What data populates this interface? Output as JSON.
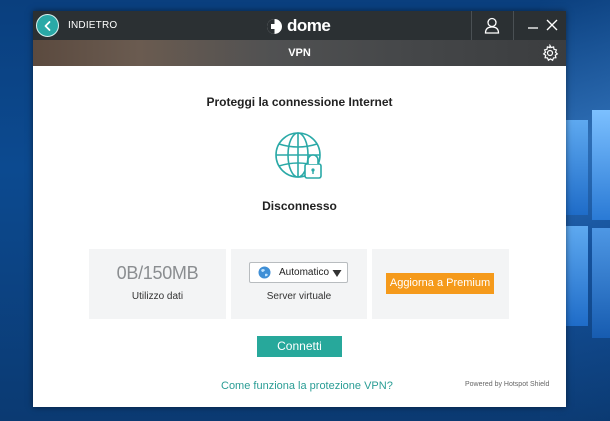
{
  "titlebar": {
    "back_label": "INDIETRO",
    "app_name": "dome"
  },
  "subbar": {
    "title": "VPN"
  },
  "main": {
    "headline": "Proteggi la connessione Internet",
    "status": "Disconnesso"
  },
  "cards": {
    "data_usage_value": "0B/150MB",
    "data_usage_label": "Utilizzo dati",
    "server_selected": "Automatico",
    "server_label": "Server virtuale",
    "upgrade_label": "Aggiorna a Premium"
  },
  "actions": {
    "connect_label": "Connetti"
  },
  "footer": {
    "help_link": "Come funziona la protezione VPN?",
    "powered_by": "Powered by Hotspot Shield"
  },
  "icons": {
    "back": "back-arrow-icon",
    "logo": "dome-logo-icon",
    "user": "user-icon",
    "minimize": "minimize-icon",
    "close": "close-icon",
    "settings": "gear-icon",
    "vpn": "globe-lock-icon",
    "server": "globe-icon",
    "dropdown": "chevron-down-icon"
  },
  "colors": {
    "accent": "#2aa9a7",
    "connect": "#27a89b",
    "upgrade": "#f59a1b",
    "titlebar": "#2b3033"
  }
}
